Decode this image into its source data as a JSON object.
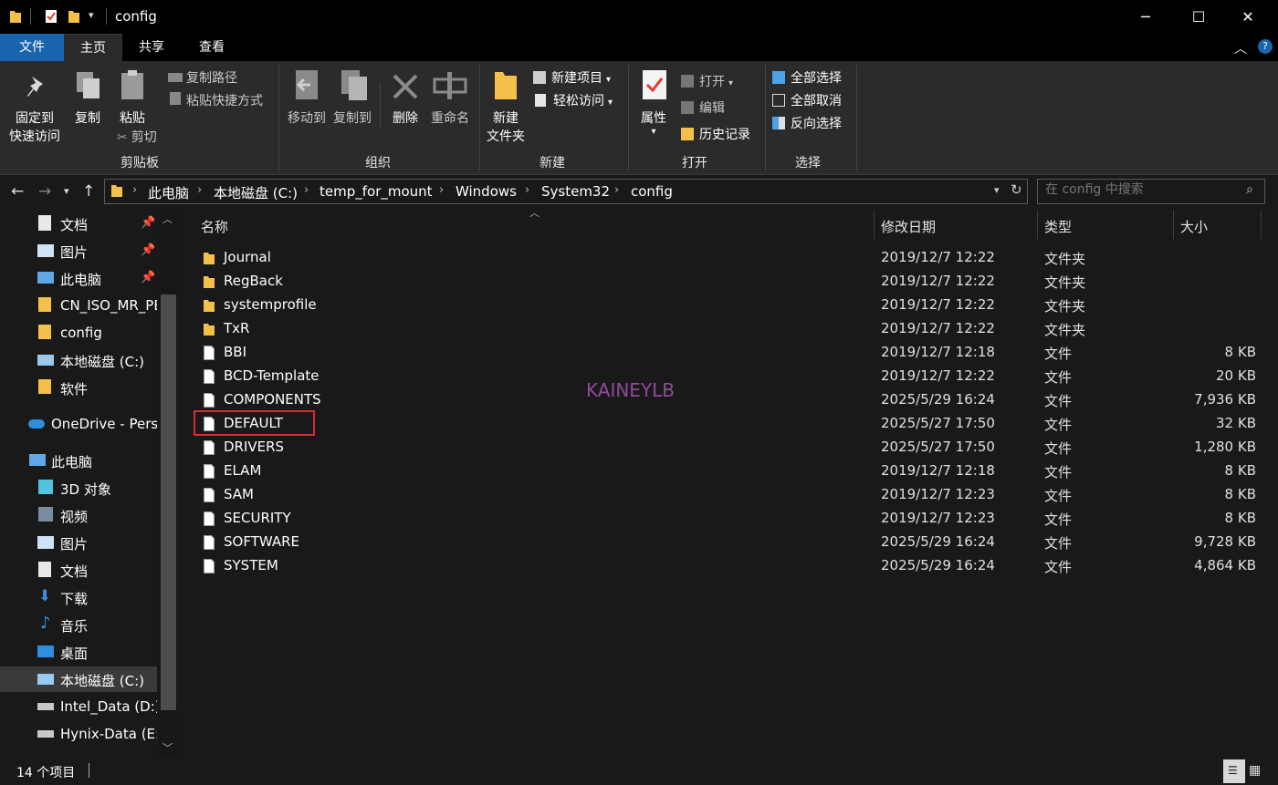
{
  "window": {
    "title": "config",
    "controls": {
      "minimize": "─",
      "maximize": "☐",
      "close": "✕"
    }
  },
  "ribbon_tabs": [
    {
      "label": "文件"
    },
    {
      "label": "主页"
    },
    {
      "label": "共享"
    },
    {
      "label": "查看"
    }
  ],
  "ribbon": {
    "clipboard": {
      "group": "剪贴板",
      "pin_line1": "固定到",
      "pin_line2": "快速访问",
      "copy": "复制",
      "paste": "粘贴",
      "copy_path": "复制路径",
      "paste_shortcut": "粘贴快捷方式",
      "cut": "剪切"
    },
    "organize": {
      "group": "组织",
      "move_to": "移动到",
      "copy_to": "复制到",
      "delete": "删除",
      "rename": "重命名"
    },
    "new": {
      "group": "新建",
      "new_folder_line1": "新建",
      "new_folder_line2": "文件夹",
      "new_item": "新建项目",
      "easy_access": "轻松访问"
    },
    "open": {
      "group": "打开",
      "properties": "属性",
      "open": "打开",
      "edit": "编辑",
      "history": "历史记录"
    },
    "select": {
      "group": "选择",
      "select_all": "全部选择",
      "select_none": "全部取消",
      "invert": "反向选择"
    }
  },
  "address": {
    "breadcrumbs": [
      "此电脑",
      "本地磁盘 (C:)",
      "temp_for_mount",
      "Windows",
      "System32",
      "config"
    ],
    "search_placeholder": "在 config 中搜索"
  },
  "nav_pane": {
    "quick": [
      {
        "label": "文档",
        "icon": "document-icon",
        "pinned": true
      },
      {
        "label": "图片",
        "icon": "picture-icon",
        "pinned": true
      },
      {
        "label": "此电脑",
        "icon": "computer-icon",
        "pinned": true
      },
      {
        "label": "CN_ISO_MR_PE",
        "icon": "folder-icon",
        "pinned": false
      },
      {
        "label": "config",
        "icon": "folder-icon",
        "pinned": false
      },
      {
        "label": "本地磁盘 (C:)",
        "icon": "drive-icon",
        "pinned": false
      },
      {
        "label": "软件",
        "icon": "folder-icon",
        "pinned": false
      }
    ],
    "onedrive": "OneDrive - Personal",
    "this_pc": "此电脑",
    "pc_items": [
      {
        "label": "3D 对象",
        "icon": "3d-objects-icon"
      },
      {
        "label": "视频",
        "icon": "video-icon"
      },
      {
        "label": "图片",
        "icon": "picture-icon"
      },
      {
        "label": "文档",
        "icon": "document-icon"
      },
      {
        "label": "下载",
        "icon": "download-icon"
      },
      {
        "label": "音乐",
        "icon": "music-icon"
      },
      {
        "label": "桌面",
        "icon": "desktop-icon"
      },
      {
        "label": "本地磁盘 (C:)",
        "icon": "drive-icon",
        "selected": true
      },
      {
        "label": "Intel_Data (D:)",
        "icon": "drive-icon"
      },
      {
        "label": "Hynix-Data (E:)",
        "icon": "drive-icon"
      }
    ]
  },
  "columns": {
    "name": "名称",
    "date": "修改日期",
    "type": "类型",
    "size": "大小"
  },
  "files": [
    {
      "name": "Journal",
      "date": "2019/12/7 12:22",
      "type": "文件夹",
      "size": "",
      "kind": "folder"
    },
    {
      "name": "RegBack",
      "date": "2019/12/7 12:22",
      "type": "文件夹",
      "size": "",
      "kind": "folder"
    },
    {
      "name": "systemprofile",
      "date": "2019/12/7 12:22",
      "type": "文件夹",
      "size": "",
      "kind": "folder"
    },
    {
      "name": "TxR",
      "date": "2019/12/7 12:22",
      "type": "文件夹",
      "size": "",
      "kind": "folder"
    },
    {
      "name": "BBI",
      "date": "2019/12/7 12:18",
      "type": "文件",
      "size": "8 KB",
      "kind": "file"
    },
    {
      "name": "BCD-Template",
      "date": "2019/12/7 12:22",
      "type": "文件",
      "size": "20 KB",
      "kind": "file"
    },
    {
      "name": "COMPONENTS",
      "date": "2025/5/29 16:24",
      "type": "文件",
      "size": "7,936 KB",
      "kind": "file"
    },
    {
      "name": "DEFAULT",
      "date": "2025/5/27 17:50",
      "type": "文件",
      "size": "32 KB",
      "kind": "file",
      "highlighted": true
    },
    {
      "name": "DRIVERS",
      "date": "2025/5/27 17:50",
      "type": "文件",
      "size": "1,280 KB",
      "kind": "file"
    },
    {
      "name": "ELAM",
      "date": "2019/12/7 12:18",
      "type": "文件",
      "size": "8 KB",
      "kind": "file"
    },
    {
      "name": "SAM",
      "date": "2019/12/7 12:23",
      "type": "文件",
      "size": "8 KB",
      "kind": "file"
    },
    {
      "name": "SECURITY",
      "date": "2019/12/7 12:23",
      "type": "文件",
      "size": "8 KB",
      "kind": "file"
    },
    {
      "name": "SOFTWARE",
      "date": "2025/5/29 16:24",
      "type": "文件",
      "size": "9,728 KB",
      "kind": "file"
    },
    {
      "name": "SYSTEM",
      "date": "2025/5/29 16:24",
      "type": "文件",
      "size": "4,864 KB",
      "kind": "file"
    }
  ],
  "watermark": "KAINEYLB",
  "status": {
    "count": "14 个项目"
  },
  "colors": {
    "accent": "#1a64ad",
    "folder": "#f5c04a",
    "highlight": "#d32f2f",
    "watermark": "#8e4d99"
  }
}
